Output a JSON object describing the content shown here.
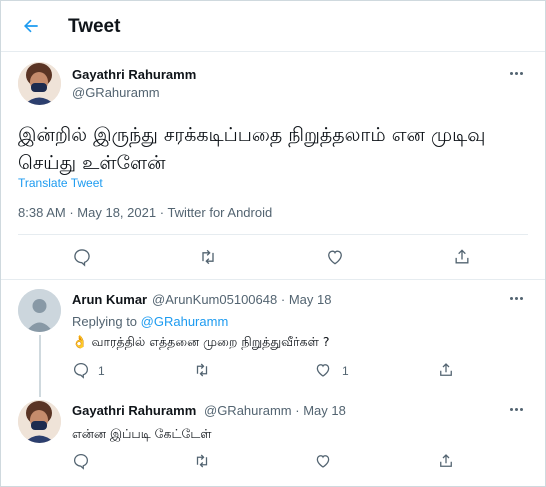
{
  "header": {
    "title": "Tweet",
    "back_icon": "arrow-left-icon"
  },
  "main_tweet": {
    "author_name": "Gayathri Rahuramm",
    "author_handle": "@GRahuramm",
    "text": "இன்றில் இருந்து சரக்கடிப்பதை நிறுத்தலாம் என முடிவு செய்து உள்ளேன்",
    "translate_label": "Translate Tweet",
    "time": "8:38 AM",
    "date": "May 18, 2021",
    "source": "Twitter for Android",
    "separator": "·"
  },
  "replies": [
    {
      "author_name": "Arun Kumar",
      "author_handle": "@ArunKum05100648",
      "date": "May 18",
      "replying_prefix": "Replying to",
      "replying_handle": "@GRahuramm",
      "text": "👌 வாரத்தில் எத்தனை முறை நிறுத்துவீர்கள் ?",
      "reply_count": "1",
      "like_count": "1"
    },
    {
      "author_name": "Gayathri Rahuramm",
      "author_handle": "@GRahuramm",
      "date": "May 18",
      "text": "என்ன இப்படி கேட்டேள்",
      "reply_count": "",
      "like_count": ""
    }
  ],
  "colors": {
    "accent": "#1d9bf0",
    "text": "#0f1419",
    "muted": "#536471",
    "border": "#e6ecf0"
  }
}
